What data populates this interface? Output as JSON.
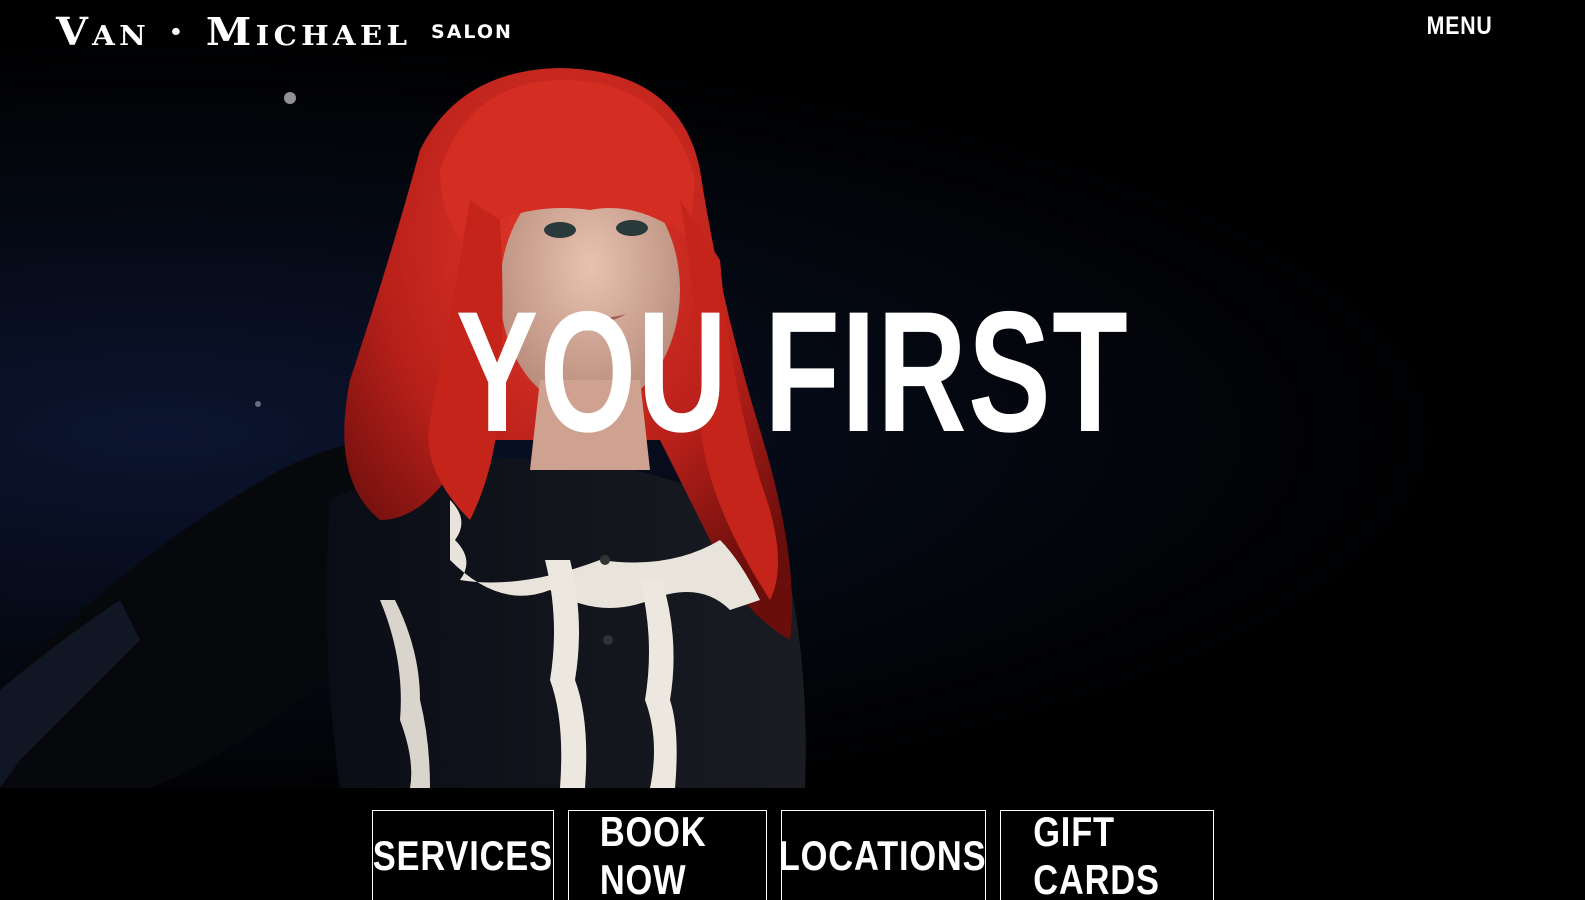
{
  "header": {
    "logo_main": "Van · Michael",
    "logo_sub": "SALON",
    "menu_label": "MENU"
  },
  "hero": {
    "title": "YOU FIRST",
    "media": "video-still-red-haired-model"
  },
  "nav": {
    "items": [
      {
        "label": "SERVICES"
      },
      {
        "label": "BOOK NOW"
      },
      {
        "label": "LOCATIONS"
      },
      {
        "label": "GIFT CARDS"
      }
    ]
  },
  "colors": {
    "background": "#000000",
    "text": "#ffffff",
    "hair": "#c8231b"
  }
}
